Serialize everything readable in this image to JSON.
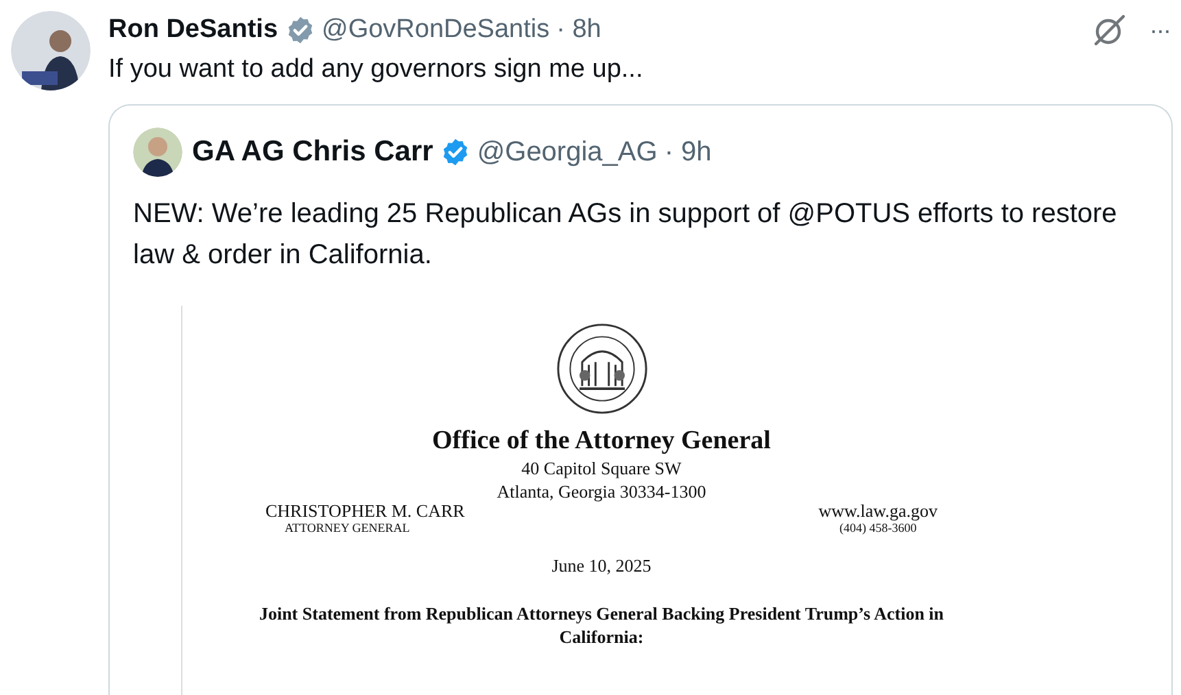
{
  "post": {
    "author": {
      "name": "Ron DeSantis",
      "verified": true,
      "handle": "@GovRonDeSantis",
      "time": "· 8h"
    },
    "text": "If you want to add any governors sign me up...",
    "actions": [
      {
        "kind": "grok"
      },
      {
        "kind": "more",
        "label": "···"
      }
    ]
  },
  "quoted_post": {
    "author": {
      "name": "GA AG Chris Carr",
      "verified": true,
      "handle": "@Georgia_AG",
      "time": "· 9h"
    },
    "text": "NEW: We’re leading 25 Republican AGs in support of @POTUS efforts to restore law & order in California.",
    "document": {
      "office": "Office of the Attorney General",
      "address": [
        "40 Capitol Square SW",
        "Atlanta, Georgia 30334-1300"
      ],
      "official_name": "CHRISTOPHER M. CARR",
      "official_title": "ATTORNEY GENERAL",
      "website": "www.law.ga.gov",
      "phone": "(404) 458-3600",
      "date": "June 10, 2025",
      "heading": "Joint Statement from Republican Attorneys General Backing President Trump’s Action in California:"
    }
  }
}
